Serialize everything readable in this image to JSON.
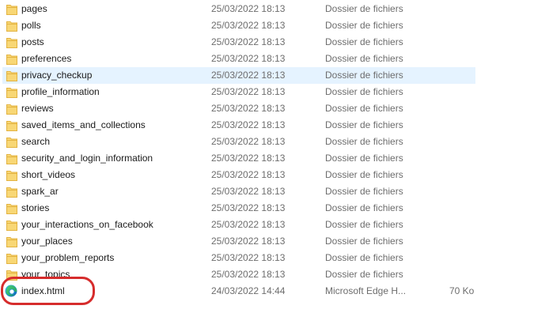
{
  "files": [
    {
      "name": "pages",
      "date": "25/03/2022 18:13",
      "type": "Dossier de fichiers",
      "size": ""
    },
    {
      "name": "polls",
      "date": "25/03/2022 18:13",
      "type": "Dossier de fichiers",
      "size": ""
    },
    {
      "name": "posts",
      "date": "25/03/2022 18:13",
      "type": "Dossier de fichiers",
      "size": ""
    },
    {
      "name": "preferences",
      "date": "25/03/2022 18:13",
      "type": "Dossier de fichiers",
      "size": ""
    },
    {
      "name": "privacy_checkup",
      "date": "25/03/2022 18:13",
      "type": "Dossier de fichiers",
      "size": ""
    },
    {
      "name": "profile_information",
      "date": "25/03/2022 18:13",
      "type": "Dossier de fichiers",
      "size": ""
    },
    {
      "name": "reviews",
      "date": "25/03/2022 18:13",
      "type": "Dossier de fichiers",
      "size": ""
    },
    {
      "name": "saved_items_and_collections",
      "date": "25/03/2022 18:13",
      "type": "Dossier de fichiers",
      "size": ""
    },
    {
      "name": "search",
      "date": "25/03/2022 18:13",
      "type": "Dossier de fichiers",
      "size": ""
    },
    {
      "name": "security_and_login_information",
      "date": "25/03/2022 18:13",
      "type": "Dossier de fichiers",
      "size": ""
    },
    {
      "name": "short_videos",
      "date": "25/03/2022 18:13",
      "type": "Dossier de fichiers",
      "size": ""
    },
    {
      "name": "spark_ar",
      "date": "25/03/2022 18:13",
      "type": "Dossier de fichiers",
      "size": ""
    },
    {
      "name": "stories",
      "date": "25/03/2022 18:13",
      "type": "Dossier de fichiers",
      "size": ""
    },
    {
      "name": "your_interactions_on_facebook",
      "date": "25/03/2022 18:13",
      "type": "Dossier de fichiers",
      "size": ""
    },
    {
      "name": "your_places",
      "date": "25/03/2022 18:13",
      "type": "Dossier de fichiers",
      "size": ""
    },
    {
      "name": "your_problem_reports",
      "date": "25/03/2022 18:13",
      "type": "Dossier de fichiers",
      "size": ""
    },
    {
      "name": "your_topics",
      "date": "25/03/2022 18:13",
      "type": "Dossier de fichiers",
      "size": ""
    },
    {
      "name": "index.html",
      "date": "24/03/2022 14:44",
      "type": "Microsoft Edge H...",
      "size": "70 Ko"
    }
  ],
  "colors": {
    "hover_row": "#e5f3ff",
    "highlight_ring": "#d62c2c",
    "folder": "#f8d775"
  }
}
